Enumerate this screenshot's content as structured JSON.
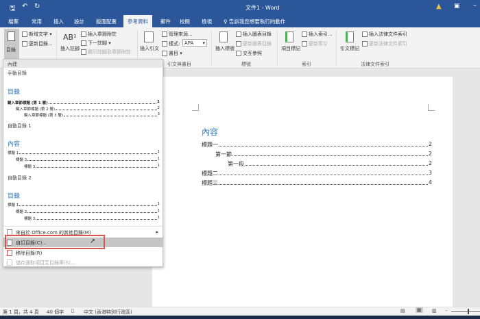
{
  "title_bar": {
    "title": "文件1 - Word",
    "qat": [
      "save-icon",
      "undo-icon",
      "redo-icon"
    ]
  },
  "tabs": [
    "檔案",
    "常用",
    "插入",
    "設計",
    "版面配置",
    "參考資料",
    "郵件",
    "校閱",
    "檢視"
  ],
  "active_tab": "參考資料",
  "tell_me": "告訴我您想要執行的動作",
  "ribbon": {
    "toc": {
      "button": "目錄",
      "add_text": "新增文字",
      "update": "更新目錄...",
      "group": "內建"
    },
    "footnotes": {
      "insert": "插入註腳",
      "insert_endnote": "插入章節附註",
      "next": "下一註腳",
      "show": "顯示註腳及章節附註"
    },
    "citations": {
      "insert": "插入引文",
      "manage": "管理來源...",
      "style_label": "樣式:",
      "style_value": "APA",
      "bibliography": "書目",
      "group": "引文與書目"
    },
    "captions": {
      "insert": "插入標號",
      "insert_table": "插入圖表目錄",
      "update_table": "更新圖表目錄",
      "cross_ref": "交互參照",
      "group": "標號"
    },
    "index": {
      "mark": "項目標記",
      "insert": "插入索引...",
      "update": "更新索引",
      "group": "索引"
    },
    "authorities": {
      "mark": "引文標記",
      "insert": "插入法律文件索引",
      "update": "更新法律文件索引",
      "group": "法律文件索引"
    }
  },
  "menu": {
    "header": "內建",
    "manual": {
      "label": "手動目錄",
      "title": "目錄",
      "entries": [
        {
          "text": "鍵入章節標題 (第 1 層)",
          "page": "1"
        },
        {
          "text": "鍵入章節標題 (第 2 層)",
          "page": "2"
        },
        {
          "text": "鍵入章節標題 (第 3 層)",
          "page": "3"
        }
      ]
    },
    "auto1": {
      "label": "自動目錄 1",
      "title": "內容",
      "entries": [
        {
          "text": "標題 1",
          "page": "1"
        },
        {
          "text": "標題 2",
          "page": "1"
        },
        {
          "text": "標題 3",
          "page": "1"
        }
      ]
    },
    "auto2": {
      "label": "自動目錄 2",
      "title": "目錄",
      "entries": [
        {
          "text": "標題 1",
          "page": "1"
        },
        {
          "text": "標題 2",
          "page": "1"
        },
        {
          "text": "標題 3",
          "page": "1"
        }
      ]
    },
    "items": [
      "來自於 Office.com 的其他目錄(M)",
      "自訂目錄(C)...",
      "移除目錄(R)",
      "儲存選取項目至目錄庫(S)..."
    ]
  },
  "document": {
    "title": "內容",
    "entries": [
      {
        "text": "標題一",
        "page": "2"
      },
      {
        "text": "第一節",
        "page": "2"
      },
      {
        "text": "第一段",
        "page": "2"
      },
      {
        "text": "標題二",
        "page": "3"
      },
      {
        "text": "標題三",
        "page": "4"
      }
    ]
  },
  "status": {
    "page": "第 1 頁，共 4 頁",
    "words": "40 個字",
    "language": "中文 (香港特別行政區)"
  },
  "colors": {
    "accent": "#2b579a",
    "heading": "#2e74b5",
    "highlight": "#d9534f"
  }
}
